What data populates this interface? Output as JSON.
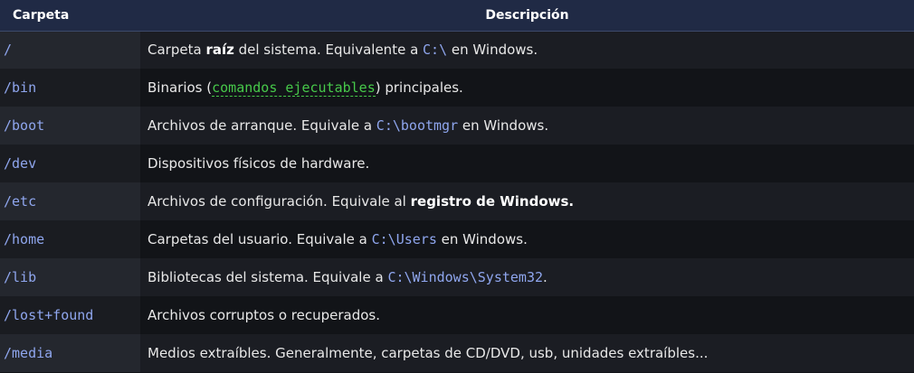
{
  "header": {
    "col_folder": "Carpeta",
    "col_description": "Descripción"
  },
  "rows": [
    {
      "folder": "/",
      "desc": {
        "t1": "Carpeta ",
        "b1": "raíz",
        "t2": " del sistema. Equivalente a ",
        "c1": "C:\\",
        "t3": " en Windows."
      }
    },
    {
      "folder": "/bin",
      "desc": {
        "t1": "Binarios (",
        "g1": "comandos ejecutables",
        "t2": ") principales."
      }
    },
    {
      "folder": "/boot",
      "desc": {
        "t1": "Archivos de arranque. Equivale a ",
        "c1": "C:\\bootmgr",
        "t2": " en Windows."
      }
    },
    {
      "folder": "/dev",
      "desc": {
        "t1": "Dispositivos físicos de hardware."
      }
    },
    {
      "folder": "/etc",
      "desc": {
        "t1": "Archivos de configuración. Equivale al ",
        "b1": "registro de Windows."
      }
    },
    {
      "folder": "/home",
      "desc": {
        "t1": "Carpetas del usuario. Equivale a ",
        "c1": "C:\\Users",
        "t2": " en Windows."
      }
    },
    {
      "folder": "/lib",
      "desc": {
        "t1": "Bibliotecas del sistema. Equivale a ",
        "c1": "C:\\Windows\\System32",
        "t2": "."
      }
    },
    {
      "folder": "/lost+found",
      "desc": {
        "t1": "Archivos corruptos o recuperados."
      }
    },
    {
      "folder": "/media",
      "desc": {
        "t1": "Medios extraíbles. Generalmente, carpetas de CD/DVD, usb, unidades extraíbles..."
      }
    }
  ]
}
